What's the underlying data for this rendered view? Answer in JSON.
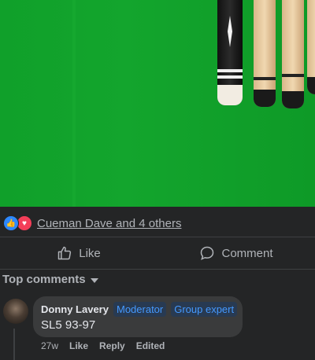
{
  "post": {
    "image": {
      "subject": "pool cues on green felt",
      "colors": {
        "felt": "#13a52d",
        "cue_black": "#111111",
        "cue_wood": "#f0d7b0"
      }
    },
    "reactions": {
      "icons": [
        "like-icon",
        "love-icon"
      ],
      "text": "Cueman Dave and 4 others"
    },
    "actions": [
      {
        "label": "Like",
        "icon": "thumbs-up-icon"
      },
      {
        "label": "Comment",
        "icon": "comment-bubble-icon"
      }
    ]
  },
  "comments_section": {
    "filter_label": "Top comments",
    "comments": [
      {
        "author": "Donny Lavery",
        "badges": [
          "Moderator",
          "Group expert"
        ],
        "text": "SL5 93-97",
        "time": "27w",
        "like_label": "Like",
        "reply_label": "Reply",
        "edited_label": "Edited"
      }
    ]
  },
  "colors": {
    "background": "#242526",
    "bubble": "#3a3b3c",
    "badge_text": "#4599ff",
    "like_blue": "#2d88ff",
    "love_red": "#f33e58"
  }
}
